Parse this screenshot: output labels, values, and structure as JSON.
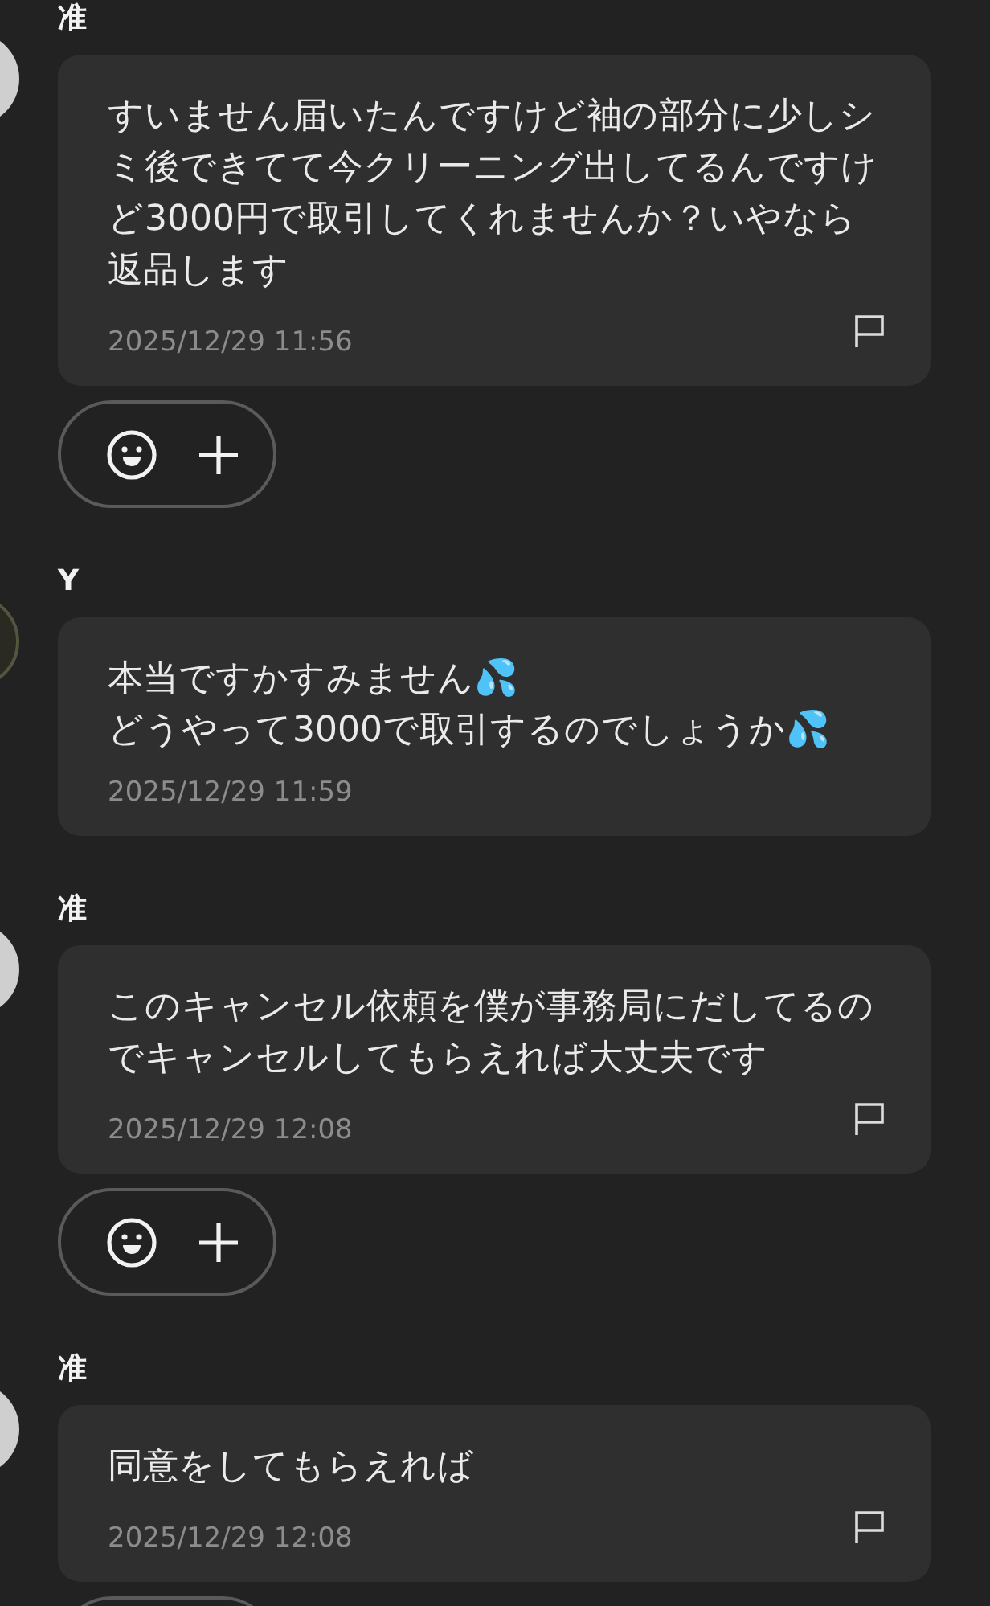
{
  "messages": [
    {
      "sender": "准",
      "avatar": {
        "color": "#cfcfcf"
      },
      "text": "すいません届いたんですけど袖の部分に少しシミ後できてて今クリーニング出してるんですけど3000円で取引してくれませんか？いやなら返品します",
      "time": "2025/12/29 11:56",
      "reportable": true,
      "reaction_bar": true
    },
    {
      "sender": "Y",
      "avatar": {
        "color": "#2b2a22"
      },
      "text": "本当ですかすみません💦\nどうやって3000で取引するのでしょうか💦",
      "time": "2025/12/29 11:59",
      "reportable": false,
      "reaction_bar": false
    },
    {
      "sender": "准",
      "avatar": {
        "color": "#cfcfcf"
      },
      "text": "このキャンセル依頼を僕が事務局にだしてるのでキャンセルしてもらえれば大丈夫です",
      "time": "2025/12/29 12:08",
      "reportable": true,
      "reaction_bar": true
    },
    {
      "sender": "准",
      "avatar": {
        "color": "#cfcfcf"
      },
      "text": "同意をしてもらえれば",
      "time": "2025/12/29 12:08",
      "reportable": true,
      "reaction_bar": true
    }
  ]
}
